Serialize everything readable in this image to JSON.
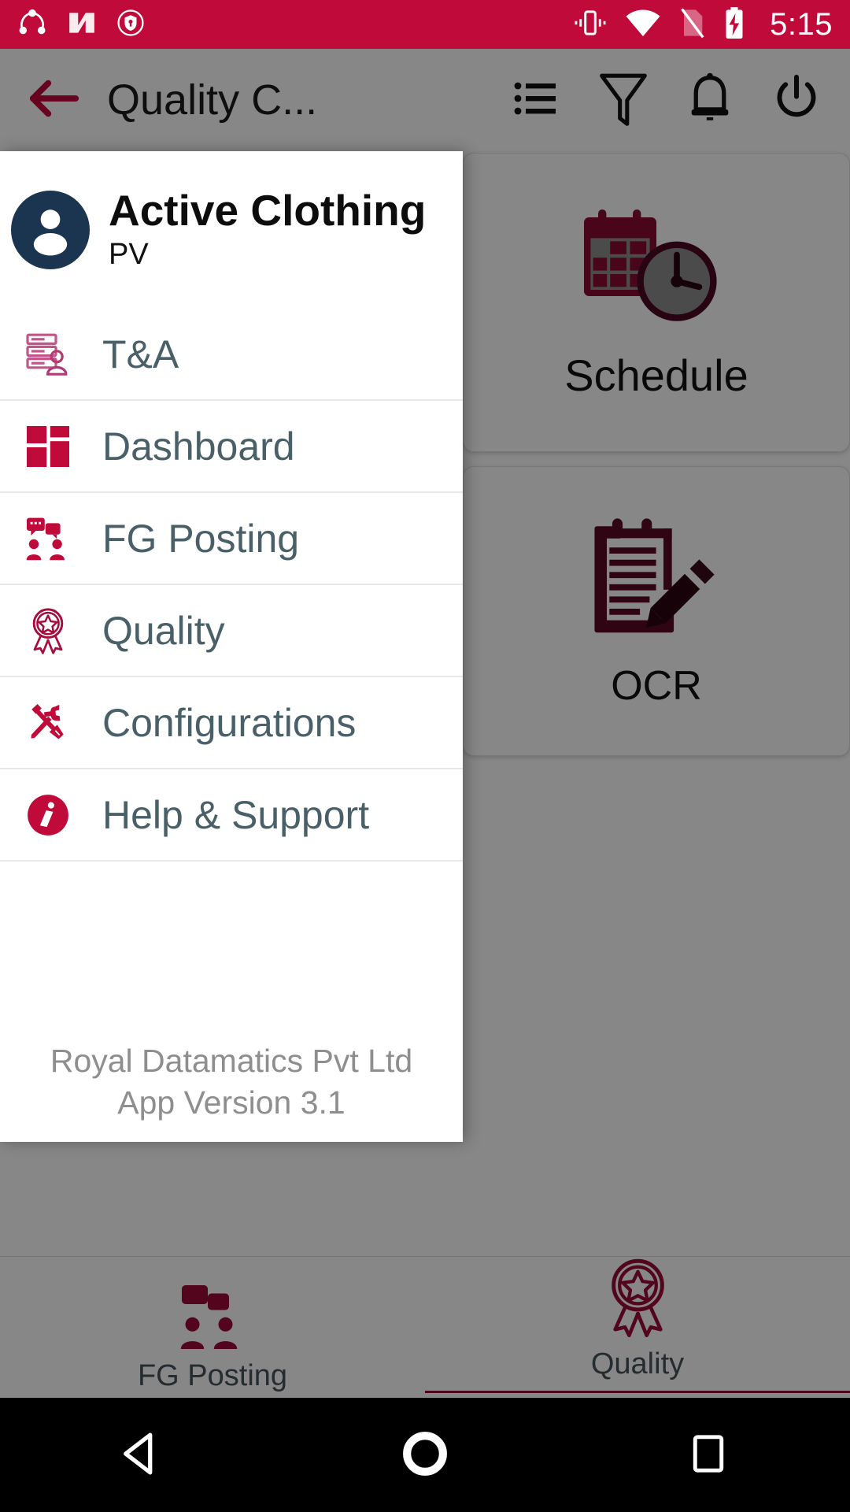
{
  "theme": {
    "primary": "#bf0a3a",
    "accent_dark": "#8e0b32",
    "menu_text": "#4a6069",
    "avatar_bg": "#1b3550",
    "footer_text": "#8e8e8e",
    "scrim": "rgba(0,0,0,0.47)"
  },
  "status_bar": {
    "time": "5:15",
    "left_icons": [
      "share-app-icon",
      "android-nougat-icon",
      "security-shield-icon"
    ],
    "right_icons": [
      "vibrate-icon",
      "wifi-icon",
      "no-sim-icon",
      "battery-charging-icon"
    ]
  },
  "app_bar": {
    "back_icon": "arrow-left-icon",
    "title": "Quality C...",
    "actions": [
      {
        "name": "list-view-icon"
      },
      {
        "name": "filter-icon"
      },
      {
        "name": "notifications-icon"
      },
      {
        "name": "power-icon"
      }
    ]
  },
  "drawer": {
    "user": {
      "name": "Active Clothing",
      "subtitle": "PV",
      "avatar_icon": "person-avatar-icon"
    },
    "items": [
      {
        "label": "T&A",
        "icon": "time-attendance-icon"
      },
      {
        "label": "Dashboard",
        "icon": "dashboard-grid-icon"
      },
      {
        "label": "FG Posting",
        "icon": "fg-posting-icon"
      },
      {
        "label": "Quality",
        "icon": "quality-ribbon-icon"
      },
      {
        "label": "Configurations",
        "icon": "tools-icon"
      },
      {
        "label": "Help & Support",
        "icon": "info-icon"
      }
    ],
    "footer": {
      "company": "Royal Datamatics Pvt Ltd",
      "version": "App Version 3.1"
    }
  },
  "content": {
    "cards": [
      {
        "label": "Schedule",
        "icon": "calendar-clock-icon"
      },
      {
        "label": "OCR",
        "icon": "clipboard-pencil-icon"
      }
    ],
    "bottom_tabs": [
      {
        "label": "FG Posting",
        "icon": "fg-posting-icon",
        "selected": false
      },
      {
        "label": "Quality",
        "icon": "quality-ribbon-icon",
        "selected": true
      }
    ]
  },
  "nav_bar": {
    "buttons": [
      {
        "name": "android-back-button"
      },
      {
        "name": "android-home-button"
      },
      {
        "name": "android-recents-button"
      }
    ]
  }
}
